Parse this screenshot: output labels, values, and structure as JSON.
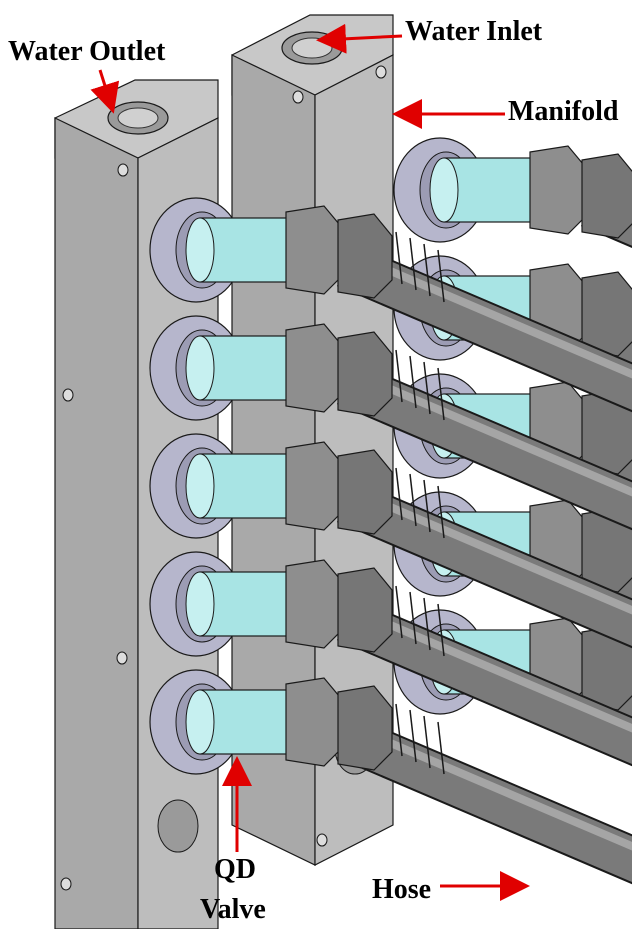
{
  "labels": {
    "water_outlet": "Water Outlet",
    "water_inlet": "Water Inlet",
    "manifold": "Manifold",
    "qd_line1": "QD",
    "qd_line2": "Valve",
    "hose": "Hose"
  },
  "colors": {
    "manifold_front": "#a9a9a9",
    "manifold_side": "#bdbdbd",
    "manifold_top": "#c8c8c8",
    "valve_body": "#a8e4e4",
    "flange": "#b6b6cc",
    "nut": "#8e8e8e",
    "hose": "#7a7a7a",
    "arrow": "#e00000",
    "edge": "#1a1a1a"
  },
  "counts": {
    "ports_per_manifold": 5
  }
}
